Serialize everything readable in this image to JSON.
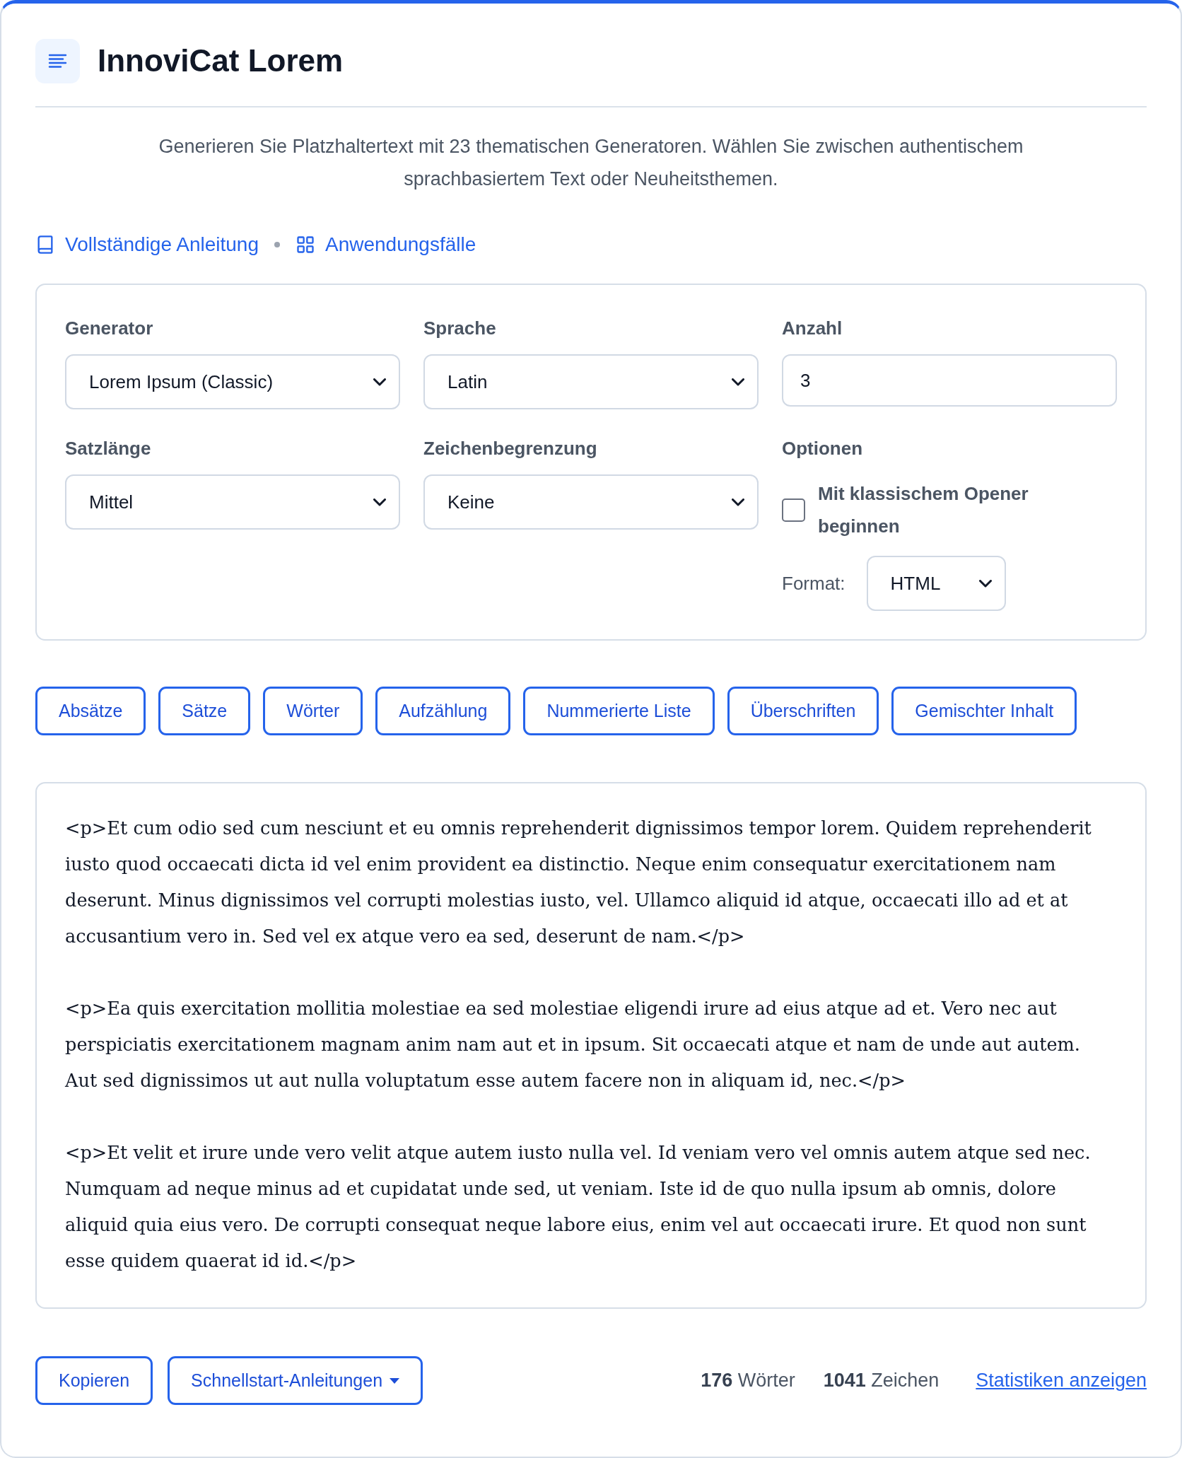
{
  "header": {
    "title": "InnoviCat Lorem"
  },
  "description": "Generieren Sie Platzhaltertext mit 23 thematischen Generatoren. Wählen Sie zwischen authentischem sprachbasiertem Text oder Neuheitsthemen.",
  "links": [
    {
      "label": "Vollständige Anleitung"
    },
    {
      "label": "Anwendungsfälle"
    }
  ],
  "settings": {
    "fields": [
      {
        "kind": "select",
        "label": "Generator",
        "value": "Lorem Ipsum (Classic)"
      },
      {
        "kind": "select",
        "label": "Sprache",
        "value": "Latin"
      },
      {
        "kind": "number",
        "label": "Anzahl",
        "value": "3"
      },
      {
        "kind": "select",
        "label": "Satzlänge",
        "value": "Mittel"
      },
      {
        "kind": "select",
        "label": "Zeichenbegrenzung",
        "value": "Keine"
      }
    ],
    "options": {
      "label": "Optionen",
      "checkbox": {
        "label": "Mit klassischem Opener beginnen",
        "checked": false
      },
      "format": {
        "label": "Format:",
        "value": "HTML"
      }
    }
  },
  "content_buttons": [
    "Absätze",
    "Sätze",
    "Wörter",
    "Aufzählung",
    "Nummerierte Liste",
    "Überschriften",
    "Gemischter Inhalt"
  ],
  "output": {
    "paragraphs": [
      "<p>Et cum odio sed cum nesciunt et eu omnis reprehenderit dignissimos tempor lorem. Quidem reprehenderit iusto quod occaecati dicta id vel enim provident ea distinctio. Neque enim consequatur exercitationem nam deserunt. Minus dignissimos vel corrupti molestias iusto, vel. Ullamco aliquid id atque, occaecati illo ad et at accusantium vero in. Sed vel ex atque vero ea sed, deserunt de nam.</p>",
      "<p>Ea quis exercitation mollitia molestiae ea sed molestiae eligendi irure ad eius atque ad et. Vero nec aut perspiciatis exercitationem magnam anim nam aut et in ipsum. Sit occaecati atque et nam de unde aut autem. Aut sed dignissimos ut aut nulla voluptatum esse autem facere non in aliquam id, nec.</p>",
      "<p>Et velit et irure unde vero velit atque autem iusto nulla vel. Id veniam vero vel omnis autem atque sed nec. Numquam ad neque minus ad et cupidatat unde sed, ut veniam. Iste id de quo nulla ipsum ab omnis, dolore aliquid quia eius vero. De corrupti consequat neque labore eius, enim vel aut occaecati irure. Et quod non sunt esse quidem quaerat id id.</p>"
    ]
  },
  "footer": {
    "buttons": [
      {
        "label": "Kopieren",
        "dropdown": false
      },
      {
        "label": "Schnellstart-Anleitungen",
        "dropdown": true
      }
    ],
    "stats": [
      "**176** Wörter",
      "**1041** Zeichen"
    ],
    "link": "Statistiken anzeigen"
  }
}
